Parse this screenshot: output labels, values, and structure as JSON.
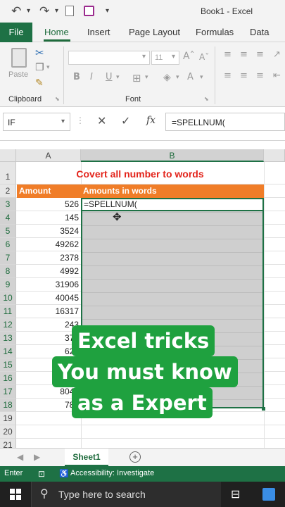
{
  "titlebar": {
    "document_title": "Book1  -  Excel",
    "quick_access": [
      "undo-icon",
      "redo-icon",
      "print-preview-icon",
      "save-icon",
      "customize-qat-icon"
    ]
  },
  "ribbon_tabs": [
    {
      "label": "File"
    },
    {
      "label": "Home"
    },
    {
      "label": "Insert"
    },
    {
      "label": "Page Layout"
    },
    {
      "label": "Formulas"
    },
    {
      "label": "Data"
    }
  ],
  "ribbon": {
    "paste_label": "Paste",
    "font_size_value": "11",
    "groups": {
      "clipboard": "Clipboard",
      "font": "Font"
    },
    "font_buttons": {
      "bold": "B",
      "italic": "I",
      "underline": "U",
      "grow": "A",
      "shrink": "A"
    }
  },
  "formula_bar": {
    "name_box": "IF",
    "fx_label": "fx",
    "formula": "=SPELLNUM("
  },
  "sheet": {
    "columns": [
      "A",
      "B"
    ],
    "rows": [
      "1",
      "2",
      "3",
      "4",
      "5",
      "6",
      "7",
      "8",
      "9",
      "10",
      "11",
      "12",
      "13",
      "14",
      "15",
      "16",
      "17",
      "18",
      "19",
      "20",
      "21"
    ],
    "title": "Covert all number to words",
    "header_amount": "Amount",
    "header_words": "Amounts in words",
    "amounts": [
      "526",
      "145",
      "3524",
      "49262",
      "2378",
      "4992",
      "31906",
      "40045",
      "16317",
      "243",
      "372",
      "626",
      "",
      "",
      "8042",
      "783"
    ],
    "active_cell_value": "=SPELLNUM("
  },
  "overlay": {
    "line1": "Excel tricks",
    "line2": "You must know",
    "line3": "as a Expert"
  },
  "sheet_tabs": {
    "active": "Sheet1"
  },
  "status": {
    "mode": "Enter",
    "accessibility": "Accessibility: Investigate"
  },
  "taskbar": {
    "search_placeholder": "Type here to search"
  },
  "colors": {
    "excel_green": "#1e7145",
    "header_orange": "#f07d28",
    "title_red": "#e3241b",
    "overlay_green": "#1fa13f"
  }
}
